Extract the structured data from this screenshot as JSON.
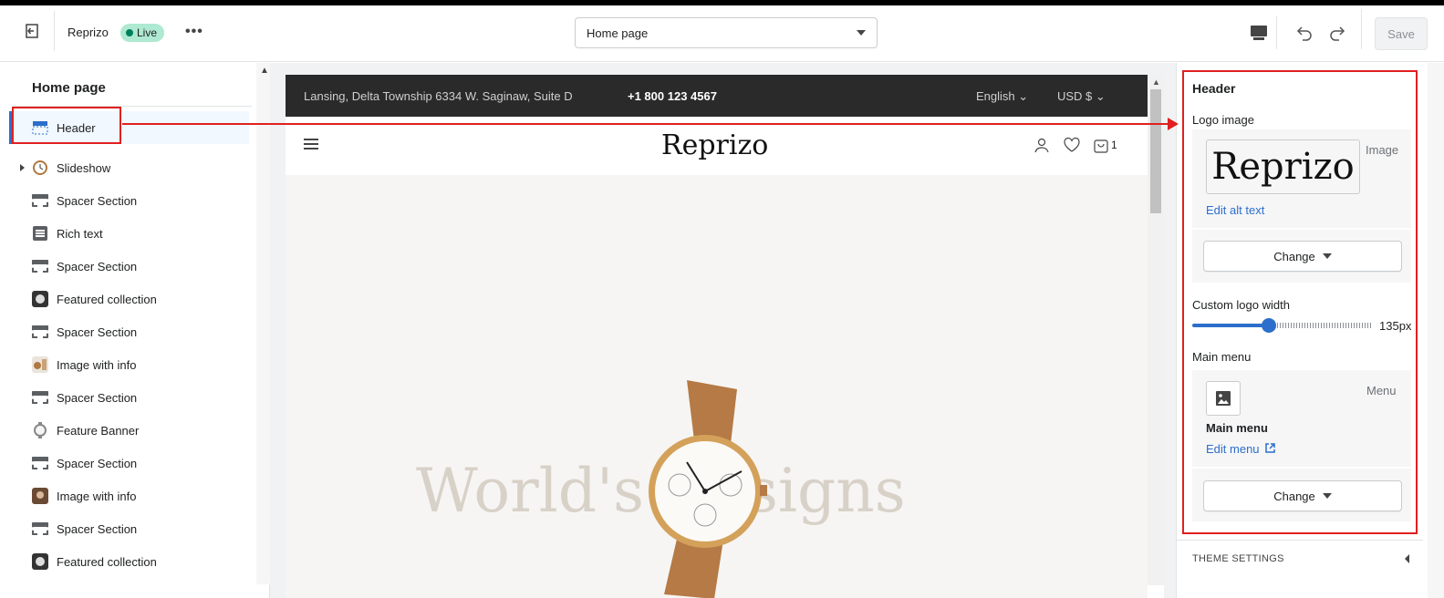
{
  "toolbar": {
    "store_name": "Reprizo",
    "status": "Live",
    "more": "•••",
    "page_select": "Home page",
    "save_label": "Save"
  },
  "sidebar": {
    "title": "Home page",
    "items": [
      {
        "label": "Header",
        "icon": "header-icon"
      },
      {
        "label": "Slideshow",
        "icon": "watch-thumb"
      },
      {
        "label": "Spacer Section",
        "icon": "spacer-icon"
      },
      {
        "label": "Rich text",
        "icon": "rich-text-icon"
      },
      {
        "label": "Spacer Section",
        "icon": "spacer-icon"
      },
      {
        "label": "Featured collection",
        "icon": "collection-thumb"
      },
      {
        "label": "Spacer Section",
        "icon": "spacer-icon"
      },
      {
        "label": "Image with info",
        "icon": "image-thumb"
      },
      {
        "label": "Spacer Section",
        "icon": "spacer-icon"
      },
      {
        "label": "Feature Banner",
        "icon": "watch-thumb"
      },
      {
        "label": "Spacer Section",
        "icon": "spacer-icon"
      },
      {
        "label": "Image with info",
        "icon": "image-thumb"
      },
      {
        "label": "Spacer Section",
        "icon": "spacer-icon"
      },
      {
        "label": "Featured collection",
        "icon": "collection-thumb"
      }
    ]
  },
  "preview": {
    "address": "Lansing, Delta Township 6334 W. Saginaw, Suite D",
    "phone": "+1 800 123 4567",
    "language": "English ⌄",
    "currency": "USD $ ⌄",
    "logo": "Reprizo",
    "cart_count": "1",
    "hero_text": "World's Designs"
  },
  "panel": {
    "title": "Header",
    "logo_label": "Logo image",
    "logo_text": "Reprizo",
    "logo_type": "Image",
    "edit_alt": "Edit alt text",
    "change_label": "Change",
    "width_label": "Custom logo width",
    "width_value": "135px",
    "width_fraction": 0.43,
    "menu_label": "Main menu",
    "menu_type": "Menu",
    "menu_name": "Main menu",
    "edit_menu": "Edit menu",
    "theme_settings": "THEME SETTINGS"
  },
  "colors": {
    "accent": "#2c6ecb",
    "live_badge": "#aee9d1",
    "annotation": "#e02020"
  }
}
